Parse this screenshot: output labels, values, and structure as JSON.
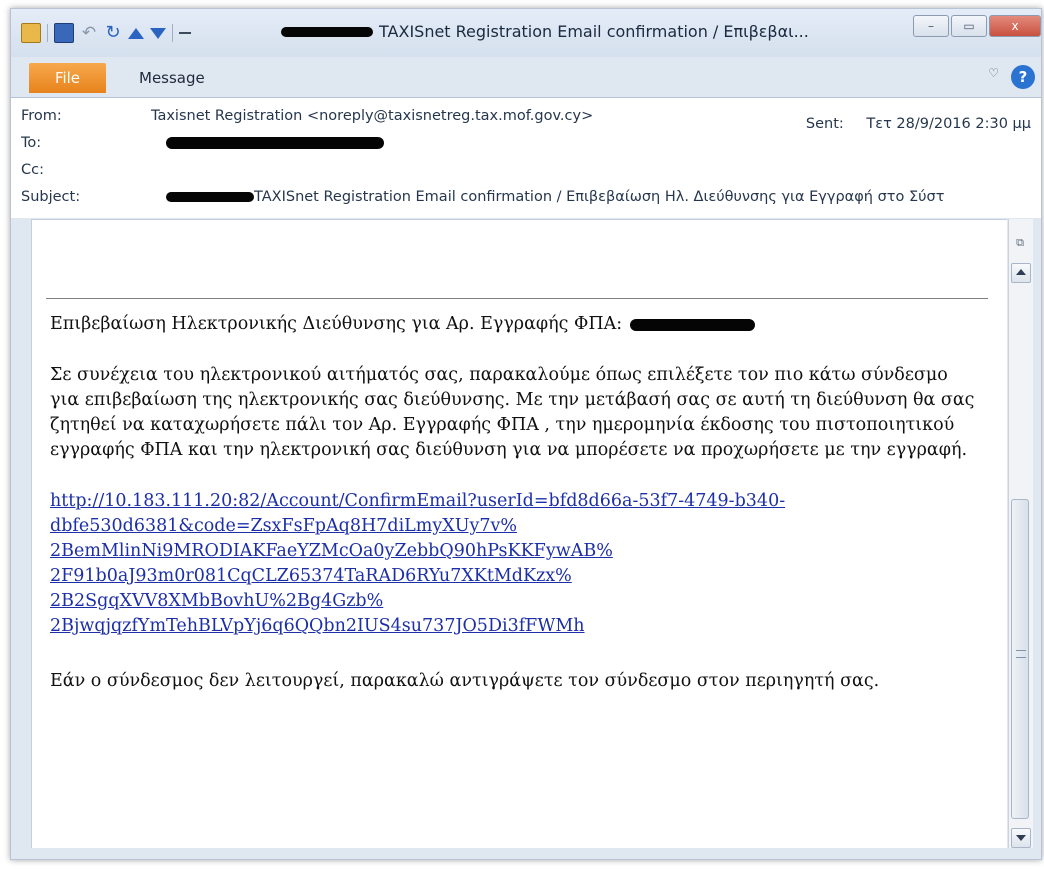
{
  "window": {
    "title": "TAXISnet Registration Email confirmation / Επιβεβαι...",
    "buttons": {
      "minimize": "–",
      "maximize": "▭",
      "close": "x"
    }
  },
  "quick_access": {
    "icons": [
      "mail-icon",
      "save-icon",
      "undo-icon",
      "redo-icon",
      "up-icon",
      "down-icon",
      "more-icon"
    ]
  },
  "ribbon": {
    "file_tab": "File",
    "message_tab": "Message",
    "help_label": "?",
    "minimize_ribbon": "♡"
  },
  "headers": {
    "from_label": "From:",
    "from_value": "Taxisnet Registration <noreply@taxisnetreg.tax.mof.gov.cy>",
    "to_label": "To:",
    "cc_label": "Cc:",
    "subject_label": "Subject:",
    "subject_value": "TAXISnet Registration Email confirmation / Επιβεβαίωση Ηλ. Διεύθυνσης για Εγγραφή στο Σύστ",
    "sent_label": "Sent:",
    "sent_value": "Τετ 28/9/2016 2:30 μμ"
  },
  "body": {
    "heading": "Επιβεβαίωση Ηλεκτρονικής Διεύθυνσης για Αρ. Εγγραφής ΦΠΑ:",
    "paragraph": "Σε συνέχεια του ηλεκτρονικού αιτήματός σας, παρακαλούμε όπως επιλέξετε τον πιο κάτω σύνδεσμο για επιβεβαίωση της ηλεκτρονικής σας διεύθυνσης. Με την μετάβασή σας σε αυτή τη διεύθυνση θα σας ζητηθεί να καταχωρήσετε πάλι τον Αρ. Εγγραφής ΦΠΑ , την ημερομηνία έκδοσης του πιστοποιητικού εγγραφής ΦΠΑ και την ηλεκτρονική σας διεύθυνση για να μπορέσετε να προχωρήσετε με την εγγραφή.",
    "link_lines": [
      "http://10.183.111.20:82/Account/ConfirmEmail?userId=bfd8d66a-53f7-4749-b340-",
      "dbfe530d6381&code=ZsxFsFpAq8H7diLmyXUy7v%",
      "2BemMlinNi9MRODIAKFaeYZMcOa0yZebbQ90hPsKKFywAB%",
      "2F91b0aJ93m0r081CqCLZ65374TaRAD6RYu7XKtMdKzx%",
      "2B2SgqXVV8XMbBovhU%2Bg4Gzb%",
      "2BjwqjqzfYmTehBLVpYj6q6QQbn2IUS4su737JO5Di3fFWMh"
    ],
    "footer": "Εάν ο σύνδεσμος δεν λειτουργεί, παρακαλώ αντιγράψετε τον σύνδεσμο στον περιηγητή σας."
  },
  "colors": {
    "file_tab": "#e7831c",
    "link": "#1c2fa8",
    "help": "#2a73d1"
  }
}
